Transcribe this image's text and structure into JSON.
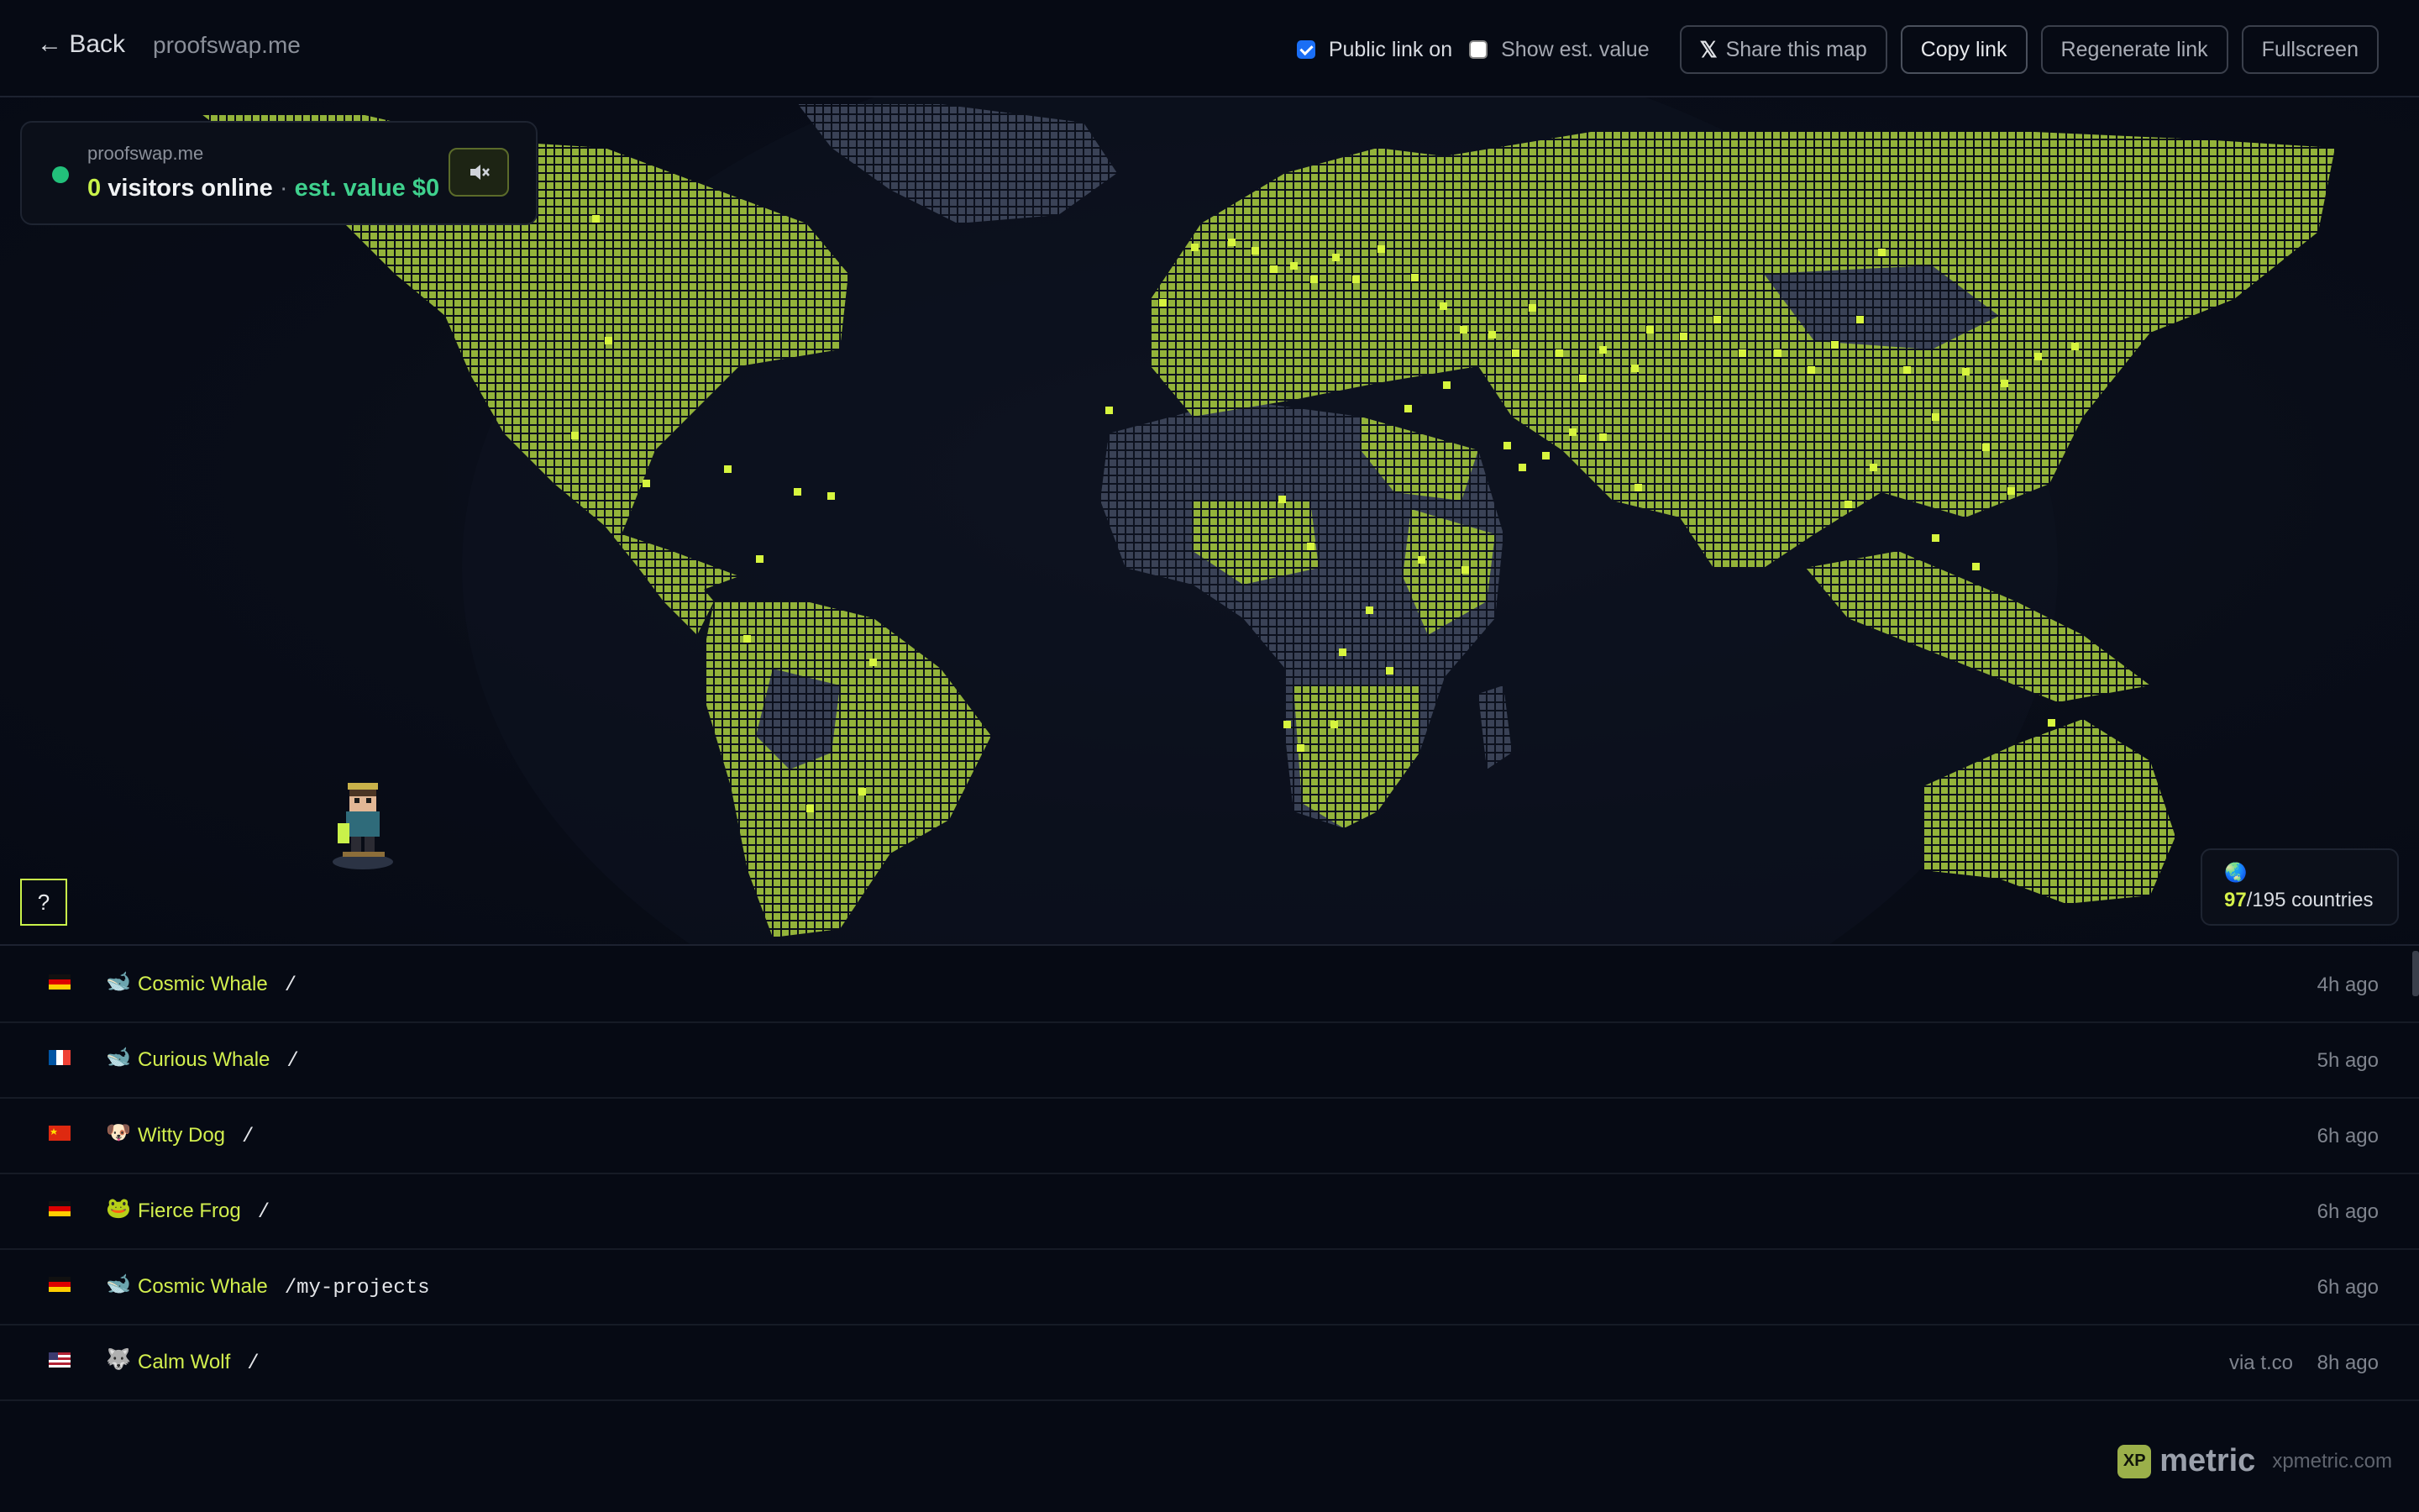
{
  "header": {
    "back_label": "← Back",
    "site": "proofswap.me",
    "public_link_label": "Public link on",
    "public_link_checked": true,
    "show_value_label": "Show est. value",
    "show_value_checked": false,
    "share_label": "Share this map",
    "copy_label": "Copy link",
    "regenerate_label": "Regenerate link",
    "fullscreen_label": "Fullscreen"
  },
  "info": {
    "site": "proofswap.me",
    "visitors_count": "0",
    "visitors_label": "visitors online",
    "separator": "·",
    "value_text": "est. value $0",
    "sound_icon": "speaker-muted-icon"
  },
  "map": {
    "help_label": "?",
    "countries_visited": "97",
    "countries_total": "/195 countries",
    "globe_icon": "globe-icon",
    "land_active_color": "#93b33a",
    "land_inactive_color": "#3a4256",
    "marker_color": "#d7f53e"
  },
  "feed": [
    {
      "flag": "de",
      "emoji": "🐋",
      "name": "Cosmic Whale",
      "path": "/",
      "ref": "",
      "time": "4h ago"
    },
    {
      "flag": "fr",
      "emoji": "🐋",
      "name": "Curious Whale",
      "path": "/",
      "ref": "",
      "time": "5h ago"
    },
    {
      "flag": "cn",
      "emoji": "🐶",
      "name": "Witty Dog",
      "path": "/",
      "ref": "",
      "time": "6h ago"
    },
    {
      "flag": "de",
      "emoji": "🐸",
      "name": "Fierce Frog",
      "path": "/",
      "ref": "",
      "time": "6h ago"
    },
    {
      "flag": "de",
      "emoji": "🐋",
      "name": "Cosmic Whale",
      "path": "/my-projects",
      "ref": "",
      "time": "6h ago"
    },
    {
      "flag": "us",
      "emoji": "🐺",
      "name": "Calm Wolf",
      "path": "/",
      "ref": "via t.co",
      "time": "8h ago"
    }
  ],
  "brand": {
    "badge": "XP",
    "name": "metric",
    "url": "xpmetric.com"
  }
}
